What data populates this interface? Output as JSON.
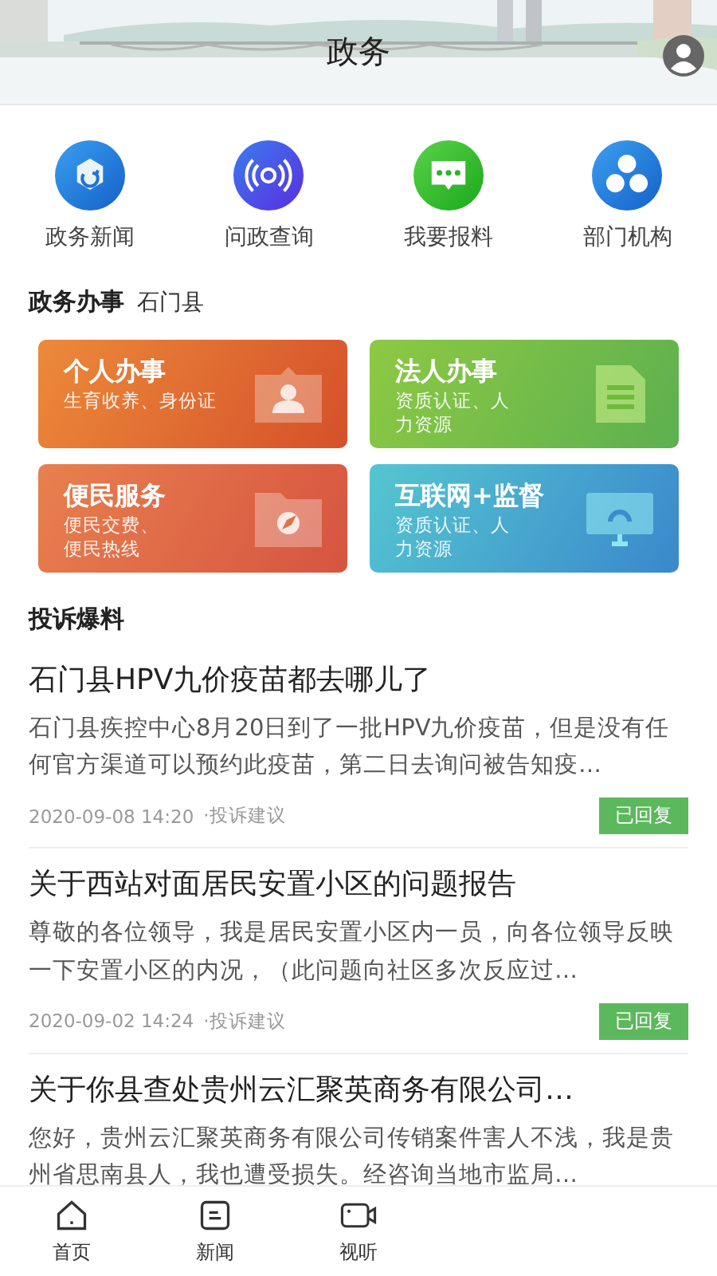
{
  "header": {
    "title": "政务"
  },
  "quick_links": [
    {
      "label": "政务新闻",
      "kind": "news"
    },
    {
      "label": "问政查询",
      "kind": "query"
    },
    {
      "label": "我要报料",
      "kind": "report"
    },
    {
      "label": "部门机构",
      "kind": "org"
    }
  ],
  "services": {
    "heading": "政务办事",
    "location": "石门县",
    "cards": [
      {
        "title": "个人办事",
        "subtitle": "生育收养、身份证",
        "kind": "person"
      },
      {
        "title": "法人办事",
        "subtitle": "资质认证、人力资源",
        "kind": "document"
      },
      {
        "title": "便民服务",
        "subtitle": "便民交费、便民热线",
        "kind": "folder"
      },
      {
        "title": "互联网+监督",
        "subtitle": "资质认证、人力资源",
        "kind": "monitor"
      }
    ]
  },
  "complaints": {
    "heading": "投诉爆料",
    "items": [
      {
        "title": "石门县HPV九价疫苗都去哪儿了",
        "summary": "石门县疾控中心8月20日到了一批HPV九价疫苗，但是没有任何官方渠道可以预约此疫苗，第二日去询问被告知疫…",
        "date": "2020-09-08 14:20",
        "category": "·投诉建议",
        "status": "已回复"
      },
      {
        "title": "关于西站对面居民安置小区的问题报告",
        "summary": "尊敬的各位领导，我是居民安置小区内一员，向各位领导反映一下安置小区的内况，（此问题向社区多次反应过…",
        "date": "2020-09-02 14:24",
        "category": "·投诉建议",
        "status": "已回复"
      },
      {
        "title": "关于你县查处贵州云汇聚英商务有限公司…",
        "summary": "您好，贵州云汇聚英商务有限公司传销案件害人不浅，我是贵州省思南县人，我也遭受损失。经咨询当地市监局…"
      }
    ]
  },
  "bottom_nav": [
    {
      "label": "首页",
      "kind": "home"
    },
    {
      "label": "新闻",
      "kind": "news"
    },
    {
      "label": "视听",
      "kind": "video"
    }
  ]
}
